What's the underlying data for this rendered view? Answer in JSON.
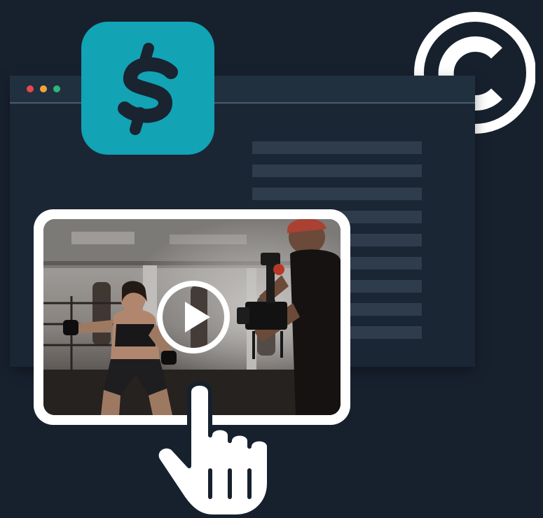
{
  "colors": {
    "background": "#17212e",
    "window_body": "#1b2634",
    "window_titlebar": "#20303f",
    "text_placeholder": "#2e3c4c",
    "brand_teal": "#12a3b5",
    "white": "#ffffff",
    "dot_red": "#e5484d",
    "dot_yellow": "#f2a33a",
    "dot_green": "#2fb57a"
  },
  "icons": {
    "copyright": "copyright-icon",
    "dollar": "dollar-sign-icon",
    "play": "play-icon",
    "hand": "hand-pointer-icon"
  },
  "browser": {
    "placeholder_line_count": 9
  },
  "video": {
    "thumbnail": "fitness-video-thumbnail"
  }
}
